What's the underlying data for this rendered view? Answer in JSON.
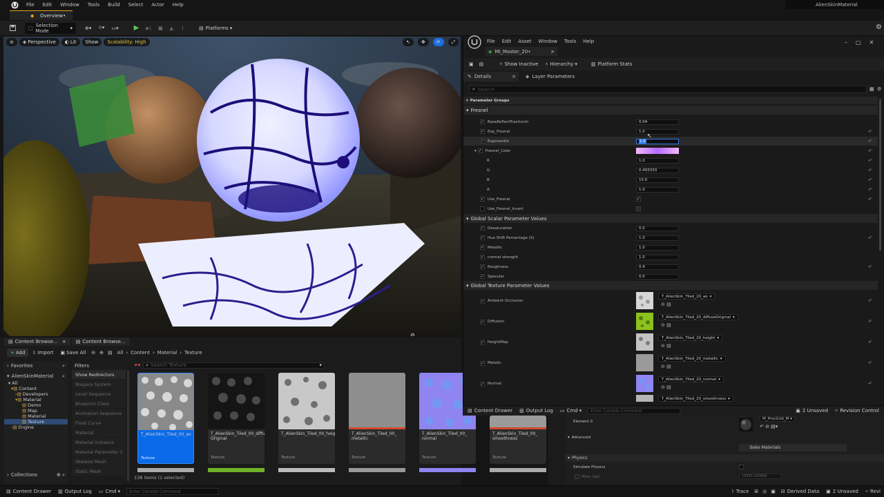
{
  "menubar": {
    "items": [
      "File",
      "Edit",
      "Window",
      "Tools",
      "Build",
      "Select",
      "Actor",
      "Help"
    ],
    "project": "AlienSkinMaterial"
  },
  "tabbar": {
    "doc_tab": "Overview•"
  },
  "toolbar": {
    "mode": "Selection Mode",
    "platforms": "Platforms"
  },
  "viewport": {
    "perspective": "Perspective",
    "lit": "Lit",
    "show": "Show",
    "scalability": "Scalability: High"
  },
  "cb": {
    "tabs": [
      "Content Browse...",
      "Content Browse..."
    ],
    "add": "Add",
    "import": "Import",
    "save_all": "Save All",
    "breadcrumb": [
      "All",
      "Content",
      "Material",
      "Texture"
    ],
    "favorites": "Favorites",
    "project": "AlienSkinMaterial",
    "collections": "Collections",
    "tree": [
      "All",
      "Content",
      "Developers",
      "Material",
      "Demo",
      "Map",
      "Material",
      "Texture",
      "Engine"
    ],
    "filters_title": "Filters",
    "filters": [
      "Show Redirectors",
      "Niagara System",
      "Level Sequence",
      "Blueprint Class",
      "Animation Sequence",
      "Float Curve",
      "Material",
      "Material Instance",
      "Material Parameter C",
      "Skeletal Mesh",
      "Static Mesh"
    ],
    "search_placeholder": "Search Texture",
    "assets": [
      {
        "name": "T_AlienSkin_Tiled_00_ao",
        "type": "Texture"
      },
      {
        "name": "T_AlienSkin_Tiled_00_diffuse Original",
        "type": "Texture"
      },
      {
        "name": "T_AlienSkin_Tiled_00_height",
        "type": "Texture"
      },
      {
        "name": "T_AlienSkin_Tiled_00_ metallic",
        "type": "Texture"
      },
      {
        "name": "T_AlienSkin_Tiled_00_ normal",
        "type": "Texture"
      },
      {
        "name": "T_AlienSkin_Tiled_00_ smoothness",
        "type": "Texture"
      }
    ],
    "count": "138 items (1 selected)"
  },
  "mi": {
    "menu": [
      "File",
      "Edit",
      "Asset",
      "Window",
      "Tools",
      "Help"
    ],
    "tab": "MI_Master_20•",
    "show_inactive": "Show Inactive",
    "hierarchy": "Hierarchy",
    "platform_stats": "Platform Stats",
    "details_tab": "Details",
    "layer_tab": "Layer Parameters",
    "search_placeholder": "Search",
    "param_groups": "Parameter Groups",
    "fresnel": "Fresnel",
    "fresnel_params": [
      {
        "name": "BaseReflectFractionIn",
        "value": "0.04"
      },
      {
        "name": "Exp_Fresnel",
        "value": "1.0"
      },
      {
        "name": "ExponentIn",
        "value": "1.0"
      }
    ],
    "fresnel_color": "Fresnel_Color",
    "color_channels": [
      {
        "name": "R",
        "value": "1.0"
      },
      {
        "name": "G",
        "value": "0.493333"
      },
      {
        "name": "B",
        "value": "15.0"
      },
      {
        "name": "A",
        "value": "1.0"
      }
    ],
    "use_fresnel": "Use_Fresnel",
    "use_fresnel_invert": "Use_Fresnel_Invert",
    "scalar_section": "Global Scalar Parameter Values",
    "scalar_params": [
      {
        "name": "Desaturation",
        "value": "0.0"
      },
      {
        "name": "Hue Shift Percentage (S)",
        "value": "1.0"
      },
      {
        "name": "Metallic",
        "value": "1.0"
      },
      {
        "name": "normal strength",
        "value": "1.0"
      },
      {
        "name": "Roughness",
        "value": "0.4"
      },
      {
        "name": "Specular",
        "value": "0.0"
      }
    ],
    "texture_section": "Global Texture Parameter Values",
    "texture_params": [
      {
        "name": "Ambient Occlusion",
        "tex": "T_AlienSkin_Tiled_20_ao"
      },
      {
        "name": "Diffusion",
        "tex": "T_AlienSkin_Tiled_20_diffuseOriginal"
      },
      {
        "name": "HeightMap",
        "tex": "T_AlienSkin_Tiled_20_height"
      },
      {
        "name": "Metalic",
        "tex": "T_AlienSkin_Tiled_20_metallic"
      },
      {
        "name": "Normal",
        "tex": "T_AlienSkin_Tiled_20_normal"
      }
    ],
    "last_tex": "T_AlienSkin_Tiled_20_smoothness"
  },
  "midbar": {
    "content_drawer": "Content Drawer",
    "output_log": "Output Log",
    "cmd": "Cmd",
    "console_placeholder": "Enter Console Command",
    "unsaved": "2 Unsaved",
    "revision": "Revision Control"
  },
  "lower": {
    "element": "Element 0",
    "material": "M_ProcGrid_M",
    "advanced": "Advanced",
    "bake": "Bake Materials",
    "physics": "Physics",
    "simulate": "Simulate Physics",
    "mass": "Mass (kg)",
    "mass_val": "15955.420898"
  },
  "statusbar": {
    "content_drawer": "Content Drawer",
    "output_log": "Output Log",
    "cmd": "Cmd",
    "console_placeholder": "Enter Console Command",
    "trace": "Trace",
    "derived": "Derived Data",
    "unsaved": "2 Unsaved",
    "rev": "Revi"
  }
}
